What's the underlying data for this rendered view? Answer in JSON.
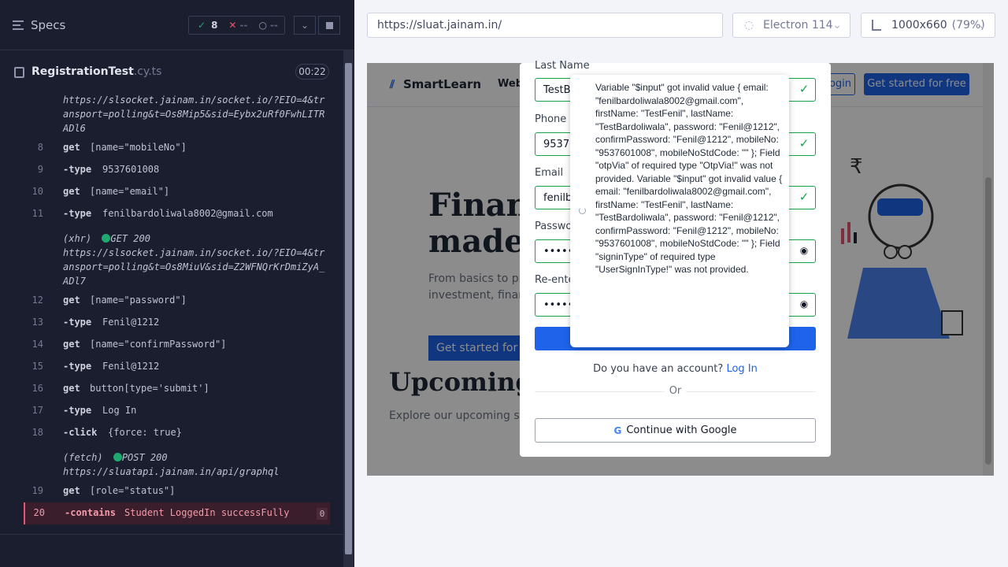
{
  "reporter": {
    "specs_label": "Specs",
    "passed_count": "8",
    "failed_count": "--",
    "pending_count": "--",
    "spec_file": "RegistrationTest",
    "spec_ext": ".cy.ts",
    "duration": "00:22"
  },
  "log": {
    "top_url": "https://slsocket.jainam.in/socket.io/?EIO=4&transport=polling&t=Os8Mip5&sid=Eybx2uRf0FwhLITRADl6",
    "rows": [
      {
        "num": "8",
        "cmd": "get",
        "arg": "[name=\"mobileNo\"]"
      },
      {
        "num": "9",
        "cmd": "-type",
        "arg": "9537601008"
      },
      {
        "num": "10",
        "cmd": "get",
        "arg": "[name=\"email\"]"
      },
      {
        "num": "11",
        "cmd": "-type",
        "arg": "fenilbardoliwala8002@gmail.com"
      },
      {
        "num": "12",
        "cmd": "get",
        "arg": "[name=\"password\"]"
      },
      {
        "num": "13",
        "cmd": "-type",
        "arg": "Fenil@1212"
      },
      {
        "num": "14",
        "cmd": "get",
        "arg": "[name=\"confirmPassword\"]"
      },
      {
        "num": "15",
        "cmd": "-type",
        "arg": "Fenil@1212"
      },
      {
        "num": "16",
        "cmd": "get",
        "arg": "button[type='submit']"
      },
      {
        "num": "17",
        "cmd": "-type",
        "arg": "Log In"
      },
      {
        "num": "18",
        "cmd": "-click",
        "arg": "{force: true}"
      },
      {
        "num": "19",
        "cmd": "get",
        "arg": "[role=\"status\"]"
      },
      {
        "num": "20",
        "cmd": "-contains",
        "arg": "Student LoggedIn successFully",
        "badge": "0"
      }
    ],
    "xhr": {
      "type": "(xhr)",
      "status": "GET 200",
      "url": "https://slsocket.jainam.in/socket.io/?EIO=4&transport=polling&t=Os8MiuV&sid=Z2WFNQrKrDmiZyA_ADl7"
    },
    "fetch": {
      "type": "(fetch)",
      "status": "POST 200",
      "url": "https://sluatapi.jainam.in/api/graphql"
    }
  },
  "browser_bar": {
    "url": "https://sluat.jainam.in/",
    "browser": "Electron 114",
    "viewport": "1000x660",
    "scale": "(79%)"
  },
  "app": {
    "brand": "SmartLearn",
    "nav_partial": "Web",
    "login_partial": "ogin",
    "get_started": "Get started for free",
    "hero_title_1": "Financ",
    "hero_title_2": "made",
    "hero_sub": "From basics to pro investment, financ trading",
    "hero_btn": "Get started for f",
    "upcoming": "Upcoming",
    "explore": "Explore our upcoming ses"
  },
  "form": {
    "last_name_label": "Last Name",
    "last_name_value": "TestBa",
    "phone_label": "Phone N",
    "phone_value": "95376",
    "email_label": "Email",
    "email_value": "fenilba",
    "password_label": "Passwor",
    "password_value": "•••••••",
    "reenter_label": "Re-ente",
    "reenter_value": "•••••••",
    "have_account": "Do you have an account?",
    "login_link": "Log In",
    "or": "Or",
    "google": "Continue with Google"
  },
  "toast": {
    "message": "Variable \"$input\" got invalid value { email: \"fenilbardoliwala8002@gmail.com\", firstName: \"TestFenil\", lastName: \"TestBardoliwala\", password: \"Fenil@1212\", confirmPassword: \"Fenil@1212\", mobileNo: \"9537601008\", mobileNoStdCode: \"\" }; Field \"otpVia\" of required type \"OtpVia!\" was not provided. Variable \"$input\" got invalid value { email: \"fenilbardoliwala8002@gmail.com\", firstName: \"TestFenil\", lastName: \"TestBardoliwala\", password: \"Fenil@1212\", confirmPassword: \"Fenil@1212\", mobileNo: \"9537601008\", mobileNoStdCode: \"\" }; Field \"signinType\" of required type \"UserSignInType!\" was not provided."
  }
}
